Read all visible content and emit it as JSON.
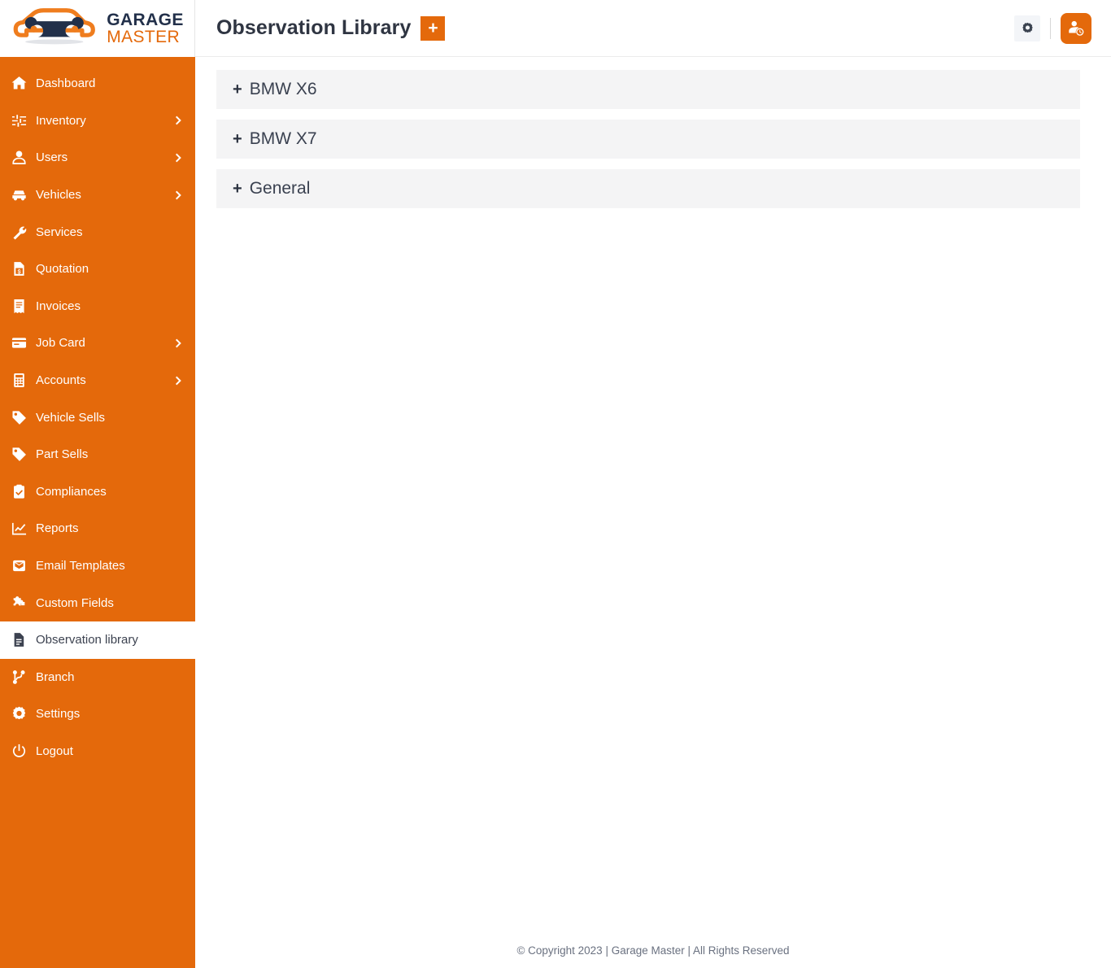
{
  "brand": {
    "line1": "GARAGE",
    "line2": "MASTER",
    "logo_icon": "car-wrench-logo-icon"
  },
  "colors": {
    "accent_orange": "#e4690b",
    "sidebar_bg": "#e4690b",
    "card_bg": "#f4f4f5",
    "title_text": "#2f3542",
    "brand_navy": "#22304a"
  },
  "sidebar": {
    "items": [
      {
        "label": "Dashboard",
        "icon": "home-icon",
        "has_caret": false,
        "active": false
      },
      {
        "label": "Inventory",
        "icon": "sliders-icon",
        "has_caret": true,
        "active": false
      },
      {
        "label": "Users",
        "icon": "user-icon",
        "has_caret": true,
        "active": false
      },
      {
        "label": "Vehicles",
        "icon": "car-icon",
        "has_caret": true,
        "active": false
      },
      {
        "label": "Services",
        "icon": "wrench-icon",
        "has_caret": false,
        "active": false
      },
      {
        "label": "Quotation",
        "icon": "file-dollar-icon",
        "has_caret": false,
        "active": false
      },
      {
        "label": "Invoices",
        "icon": "receipt-icon",
        "has_caret": false,
        "active": false
      },
      {
        "label": "Job Card",
        "icon": "id-card-icon",
        "has_caret": true,
        "active": false
      },
      {
        "label": "Accounts",
        "icon": "calculator-icon",
        "has_caret": true,
        "active": false
      },
      {
        "label": "Vehicle Sells",
        "icon": "tag-icon",
        "has_caret": false,
        "active": false
      },
      {
        "label": "Part Sells",
        "icon": "tag-icon",
        "has_caret": false,
        "active": false
      },
      {
        "label": "Compliances",
        "icon": "clipboard-check-icon",
        "has_caret": false,
        "active": false
      },
      {
        "label": "Reports",
        "icon": "chart-line-icon",
        "has_caret": false,
        "active": false
      },
      {
        "label": "Email Templates",
        "icon": "envelope-box-icon",
        "has_caret": false,
        "active": false
      },
      {
        "label": "Custom Fields",
        "icon": "puzzle-piece-icon",
        "has_caret": false,
        "active": false
      },
      {
        "label": "Observation library",
        "icon": "file-lines-icon",
        "has_caret": false,
        "active": true
      },
      {
        "label": "Branch",
        "icon": "code-branch-icon",
        "has_caret": false,
        "active": false
      },
      {
        "label": "Settings",
        "icon": "gear-icon",
        "has_caret": false,
        "active": false
      },
      {
        "label": "Logout",
        "icon": "power-off-icon",
        "has_caret": false,
        "active": false
      }
    ]
  },
  "topbar": {
    "title": "Observation Library",
    "add_label": "+",
    "settings_icon": "gear-icon",
    "profile_icon": "user-clock-icon"
  },
  "main": {
    "accordions": [
      {
        "label": "BMW X6",
        "toggle": "+",
        "expanded": false
      },
      {
        "label": "BMW X7",
        "toggle": "+",
        "expanded": false
      },
      {
        "label": "General",
        "toggle": "+",
        "expanded": false
      }
    ]
  },
  "footer": {
    "text": "© Copyright 2023 | Garage Master | All Rights Reserved"
  }
}
